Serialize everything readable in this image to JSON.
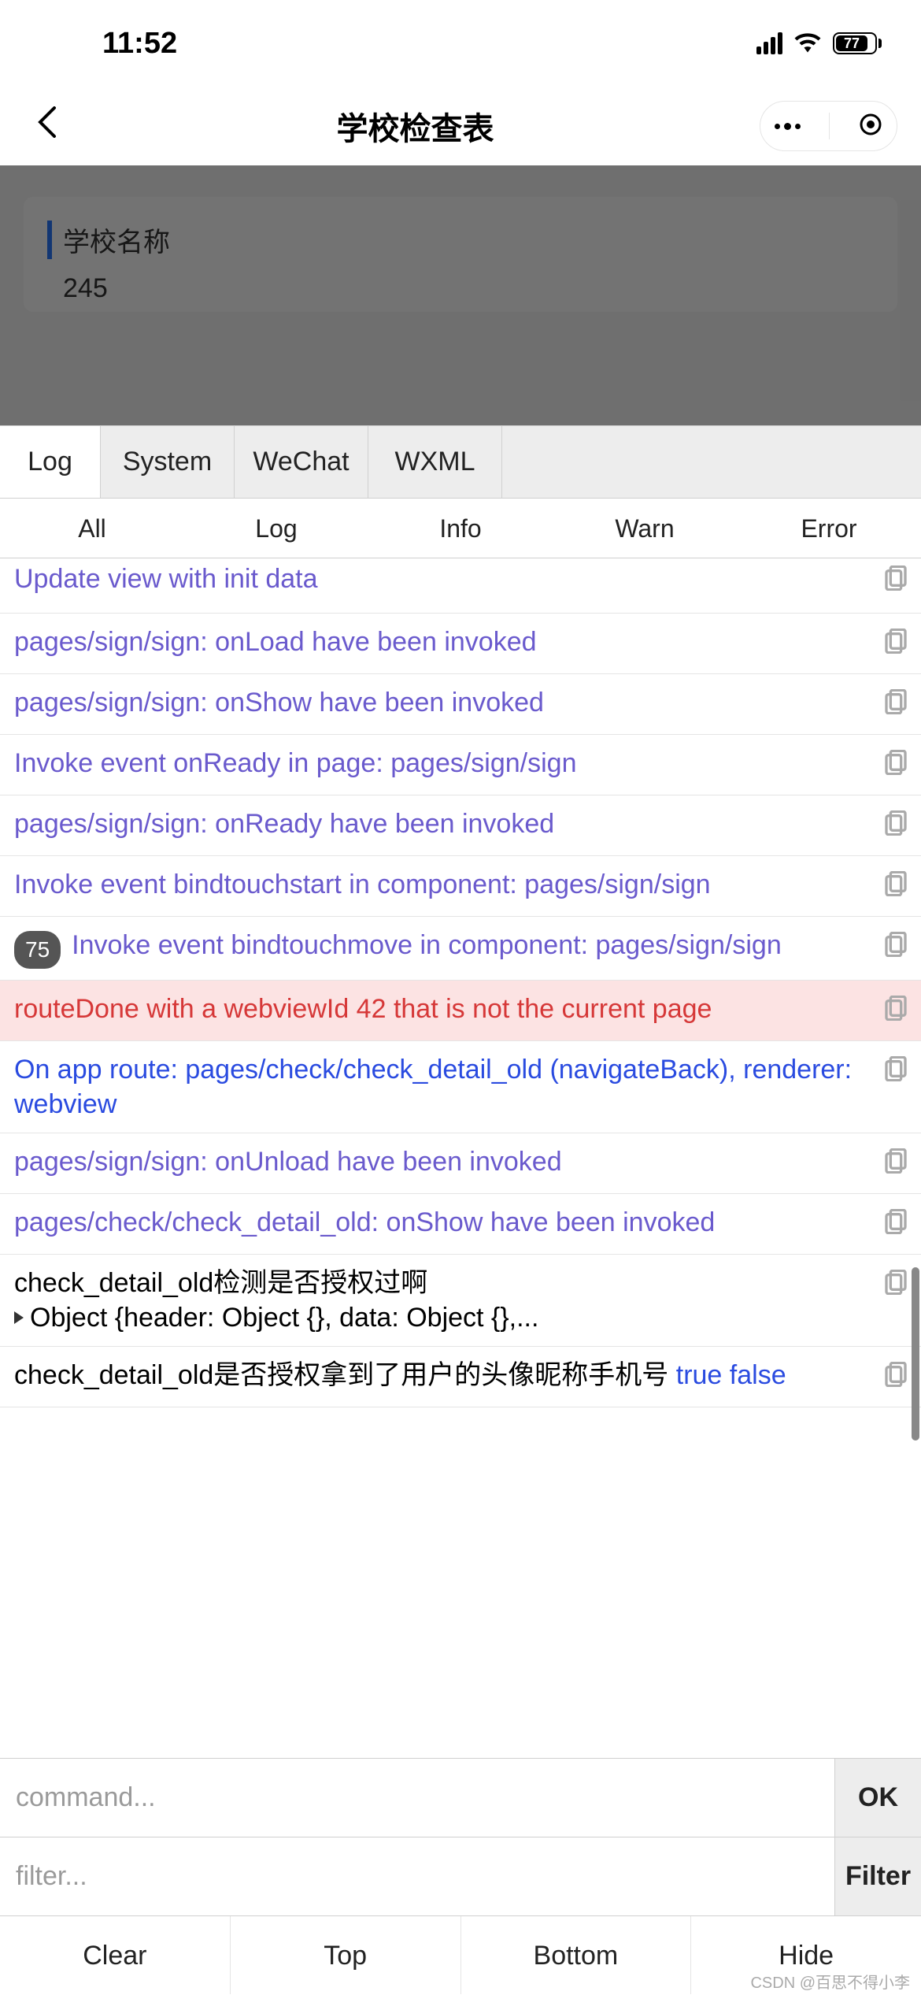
{
  "status": {
    "time": "11:52",
    "battery": "77"
  },
  "nav": {
    "title": "学校检查表"
  },
  "page": {
    "card1_label": "学校名称",
    "card1_value": "245",
    "card2_label_partial": ""
  },
  "vconsole": {
    "main_tabs": [
      "Log",
      "System",
      "WeChat",
      "WXML"
    ],
    "sub_tabs": [
      "All",
      "Log",
      "Info",
      "Warn",
      "Error"
    ],
    "logs": [
      {
        "type": "purple",
        "text": "Update view with init data"
      },
      {
        "type": "purple",
        "text": "pages/sign/sign: onLoad have been invoked"
      },
      {
        "type": "purple",
        "text": "pages/sign/sign: onShow have been invoked"
      },
      {
        "type": "purple",
        "text": "Invoke event onReady in page: pages/sign/sign"
      },
      {
        "type": "purple",
        "text": "pages/sign/sign: onReady have been invoked"
      },
      {
        "type": "purple",
        "text": "Invoke event bindtouchstart in component: pages/sign/sign"
      },
      {
        "type": "purple",
        "count": "75",
        "text": "Invoke event bindtouchmove in component: pages/sign/sign"
      },
      {
        "type": "warn",
        "text": "routeDone with a webviewId 42 that is not the current page"
      },
      {
        "type": "blue",
        "text": "On app route: pages/check/check_detail_old (navigateBack), renderer: webview"
      },
      {
        "type": "purple",
        "text": "pages/sign/sign: onUnload have been invoked"
      },
      {
        "type": "purple",
        "text": "pages/check/check_detail_old: onShow have been invoked"
      },
      {
        "type": "object",
        "text": "check_detail_old检测是否授权过啊",
        "obj": "Object {header: Object {}, data: Object {},..."
      },
      {
        "type": "mixed",
        "text": "check_detail_old是否授权拿到了用户的头像昵称手机号 ",
        "extra1": "true",
        "extra2": "false"
      }
    ],
    "cmd_placeholder": "command...",
    "cmd_btn": "OK",
    "filter_placeholder": "filter...",
    "filter_btn": "Filter",
    "toolbar": [
      "Clear",
      "Top",
      "Bottom",
      "Hide"
    ]
  },
  "watermark": "CSDN @百思不得小李"
}
